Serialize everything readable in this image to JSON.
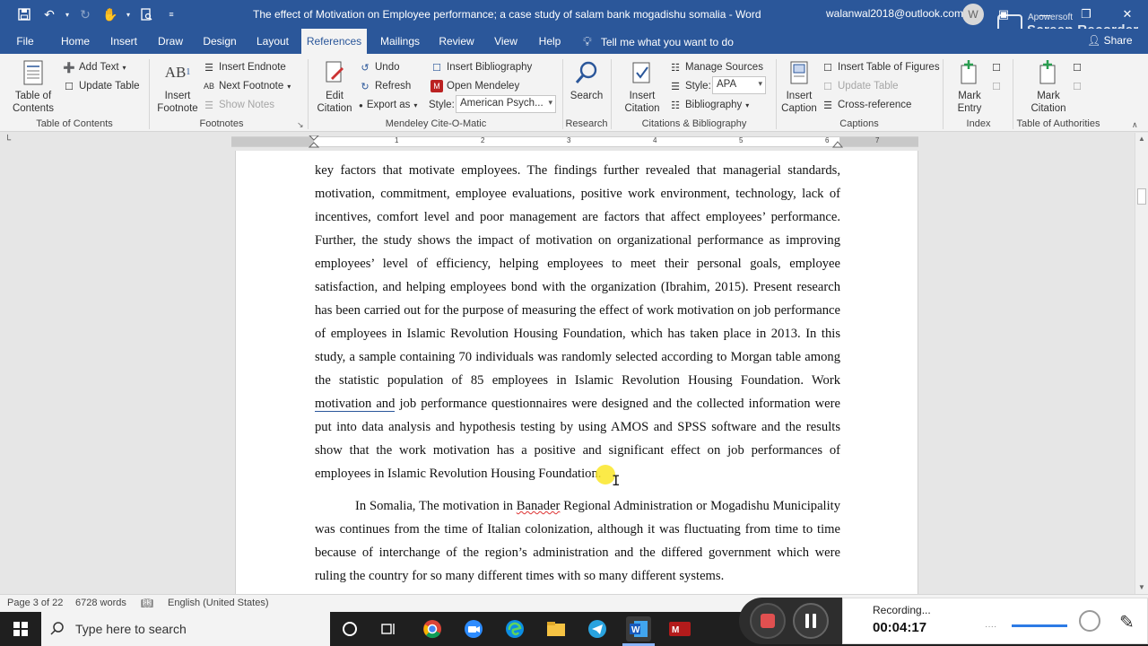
{
  "window": {
    "title": "The effect of Motivation on Employee performance; a case study of salam bank mogadishu somalia  -  Word",
    "user_email": "walanwal2018@outlook.com",
    "user_initial": "W"
  },
  "watermark": {
    "line1": "Apowersoft",
    "line2": "Screen Recorder"
  },
  "tabs": [
    {
      "label": "File"
    },
    {
      "label": "Home"
    },
    {
      "label": "Insert"
    },
    {
      "label": "Draw"
    },
    {
      "label": "Design"
    },
    {
      "label": "Layout"
    },
    {
      "label": "References"
    },
    {
      "label": "Mailings"
    },
    {
      "label": "Review"
    },
    {
      "label": "View"
    },
    {
      "label": "Help"
    }
  ],
  "tell_me": "Tell me what you want to do",
  "share": "Share",
  "ribbon": {
    "toc": {
      "table_of_contents": "Table of\nContents",
      "add_text": "Add Text",
      "update_table": "Update Table",
      "group": "Table of Contents"
    },
    "footnotes": {
      "insert_footnote": "Insert\nFootnote",
      "insert_endnote": "Insert Endnote",
      "next_footnote": "Next Footnote",
      "show_notes": "Show Notes",
      "group": "Footnotes"
    },
    "mendeley": {
      "edit_citation": "Edit\nCitation",
      "undo": "Undo",
      "refresh": "Refresh",
      "export_as": "Export as",
      "style_label": "Style:",
      "style_value": "American Psych...",
      "insert_bibliography": "Insert Bibliography",
      "open_mendeley": "Open Mendeley",
      "group": "Mendeley Cite-O-Matic"
    },
    "research": {
      "search": "Search",
      "group": "Research"
    },
    "citations": {
      "insert_citation": "Insert\nCitation",
      "manage_sources": "Manage Sources",
      "style_label": "Style:",
      "style_value": "APA",
      "bibliography": "Bibliography",
      "group": "Citations & Bibliography"
    },
    "captions": {
      "insert_caption": "Insert\nCaption",
      "insert_table_of_figures": "Insert Table of Figures",
      "update_table": "Update Table",
      "cross_reference": "Cross-reference",
      "group": "Captions"
    },
    "index": {
      "mark_entry": "Mark\nEntry",
      "group": "Index"
    },
    "authorities": {
      "mark_citation": "Mark\nCitation",
      "group": "Table of Authorities"
    }
  },
  "ruler_numbers": [
    "1",
    "2",
    "3",
    "4",
    "5",
    "6",
    "7"
  ],
  "document": {
    "p1_a": "key factors that motivate employees. The findings further revealed that managerial standards, motivation, commitment, employee evaluations, positive work environment, technology, lack of incentives, comfort level and poor management are factors that affect employees’ performance. Further, the study shows the impact of motivation on organizational performance as improving employees’ level of efficiency, helping employees to meet their personal goals, employee satisfaction, and helping employees bond with the organization (Ibrahim, 2015). Present research has been carried out for the purpose of measuring the effect of work motivation on job performance of employees in Islamic Revolution Housing Foundation, which has taken place in 2013. In this study, a sample containing 70 individuals was randomly selected according to Morgan table among the statistic population of 85 employees in Islamic Revolution Housing Foundation. Work ",
    "p1_underlined": "motivation and",
    "p1_b": " job performance questionnaires were designed and the collected information were put into data analysis and hypothesis testing by using AMOS and SPSS software and the results show that the work motivation has a positive and significant effect on job performances of employees in Islamic Revolution Housing Foundation.",
    "p2_a": "In Somalia, The motivation in ",
    "p2_squiggle": "Banader",
    "p2_b": " Regional Administration or Mogadishu Municipality was continues from the time of Italian colonization, although it was fluctuating from time to time because of interchange of the region’s administration and the differed government which were ruling the country for so many different times with so many different systems."
  },
  "status": {
    "page": "Page 3 of 22",
    "words": "6728 words",
    "language": "English (United States)"
  },
  "taskbar": {
    "search_placeholder": "Type here to search"
  },
  "recorder": {
    "label": "Recording...",
    "time": "00:04:17"
  },
  "colors": {
    "word_blue": "#2b579a",
    "ribbon_bg": "#f3f3f3",
    "taskbar": "#1f1f1f"
  }
}
